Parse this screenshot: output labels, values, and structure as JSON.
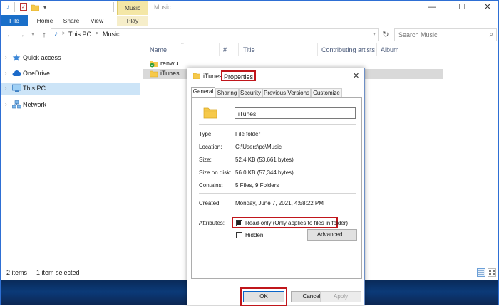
{
  "window": {
    "title": "Music",
    "contextual_tab": "Music Tools",
    "controls": {
      "minimize": "—",
      "maximize": "☐",
      "close": "✕"
    }
  },
  "ribbon": {
    "tabs": [
      {
        "label": "File"
      },
      {
        "label": "Home"
      },
      {
        "label": "Share"
      },
      {
        "label": "View"
      },
      {
        "label": "Play"
      }
    ]
  },
  "address": {
    "breadcrumbs": [
      "This PC",
      "Music"
    ],
    "separator": ">",
    "search_placeholder": "Search Music"
  },
  "nav_pane": {
    "items": [
      {
        "label": "Quick access",
        "icon": "star-icon"
      },
      {
        "label": "OneDrive",
        "icon": "cloud-icon"
      },
      {
        "label": "This PC",
        "icon": "computer-icon",
        "selected": true
      },
      {
        "label": "Network",
        "icon": "network-icon"
      }
    ]
  },
  "file_list": {
    "columns": [
      "Name",
      "#",
      "Title",
      "Contributing artists",
      "Album"
    ],
    "rows": [
      {
        "name": "renwu",
        "icon": "synced-folder-icon"
      },
      {
        "name": "iTunes",
        "icon": "folder-icon",
        "selected": true
      }
    ]
  },
  "status_bar": {
    "item_count": "2 items",
    "selection": "1 item selected"
  },
  "dialog": {
    "title_prefix": "iTunes",
    "title_suffix": "Properties",
    "close": "✕",
    "tabs": [
      "General",
      "Sharing",
      "Security",
      "Previous Versions",
      "Customize"
    ],
    "active_tab": "General",
    "folder_name": "iTunes",
    "properties": [
      {
        "label": "Type:",
        "value": "File folder"
      },
      {
        "label": "Location:",
        "value": "C:\\Users\\pc\\Music"
      },
      {
        "label": "Size:",
        "value": "52.4 KB (53,661 bytes)"
      },
      {
        "label": "Size on disk:",
        "value": "56.0 KB (57,344 bytes)"
      },
      {
        "label": "Contains:",
        "value": "5 Files, 9 Folders"
      },
      {
        "label": "Created:",
        "value": "Monday, June 7, 2021, 4:58:22 PM"
      }
    ],
    "attributes_label": "Attributes:",
    "readonly_label": "Read-only (Only applies to files in folder)",
    "hidden_label": "Hidden",
    "advanced_button": "Advanced...",
    "buttons": {
      "ok": "OK",
      "cancel": "Cancel",
      "apply": "Apply"
    }
  },
  "colors": {
    "accent": "#1a6fc9",
    "highlight_box": "#c0161b",
    "contextual_tab": "#f4e7a6",
    "selection": "#cce4f7"
  }
}
